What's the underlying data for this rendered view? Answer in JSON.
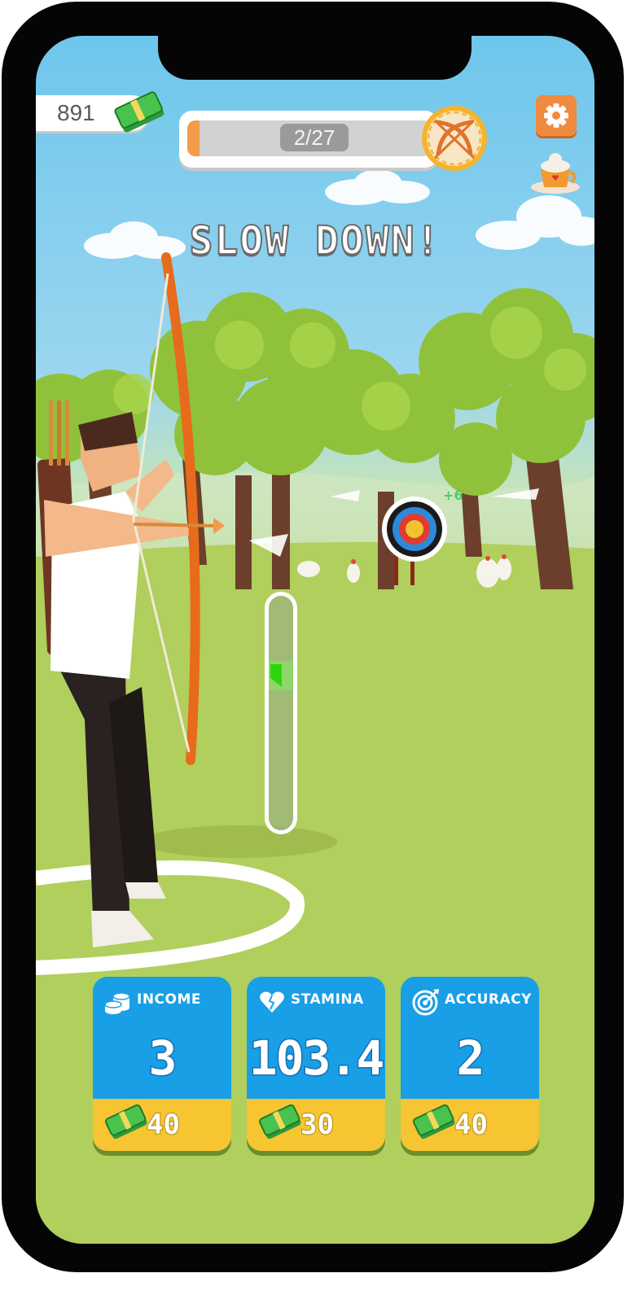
{
  "hud": {
    "money": "891",
    "level_progress": {
      "label": "2/27",
      "current": 2,
      "total": 27
    },
    "icons": [
      "cash-icon",
      "crossed-bows-icon",
      "gear-icon",
      "coffee-icon"
    ]
  },
  "message": "SLOW DOWN!",
  "scene": {
    "hit_reward": "+6"
  },
  "upgrades": [
    {
      "title": "INCOME",
      "value": "3",
      "price": "40",
      "icon": "coins-icon"
    },
    {
      "title": "STAMINA",
      "value": "103.4",
      "price": "30",
      "icon": "heart-icon"
    },
    {
      "title": "ACCURACY",
      "value": "2",
      "price": "40",
      "icon": "target-icon"
    }
  ],
  "colors": {
    "upgrade_blue": "#189fe6",
    "upgrade_yellow": "#f6c531",
    "accent_orange": "#f08a3e",
    "grass": "#b3cf5b",
    "sky": "#6ec6ec"
  }
}
